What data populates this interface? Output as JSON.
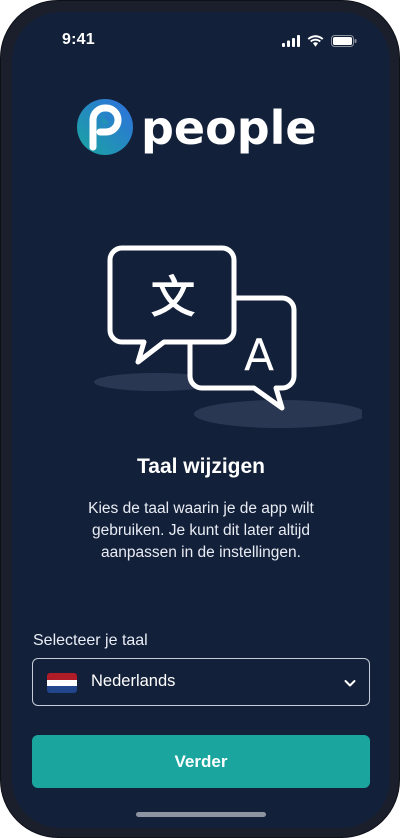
{
  "status_bar": {
    "time": "9:41",
    "icons": [
      "signal-icon",
      "wifi-icon",
      "battery-icon"
    ]
  },
  "logo": {
    "text": "people",
    "icon": "people-p-logo-icon",
    "colors": {
      "gradient_start": "#1aa59f",
      "gradient_end": "#2f6fe0"
    }
  },
  "illustration": {
    "icon": "translate-speech-bubbles-icon",
    "glyph_left": "文",
    "glyph_right": "A"
  },
  "content": {
    "title": "Taal wijzigen",
    "description": "Kies de taal waarin je de app wilt gebruiken. Je kunt dit later altijd aanpassen in de instellingen."
  },
  "language_select": {
    "label": "Selecteer je taal",
    "selected": "Nederlands",
    "flag": "netherlands-flag-icon",
    "flag_colors": [
      "#ae1c28",
      "#ffffff",
      "#21468b"
    ]
  },
  "actions": {
    "next_label": "Verder"
  },
  "colors": {
    "background": "#132039",
    "accent": "#1aa59f"
  }
}
